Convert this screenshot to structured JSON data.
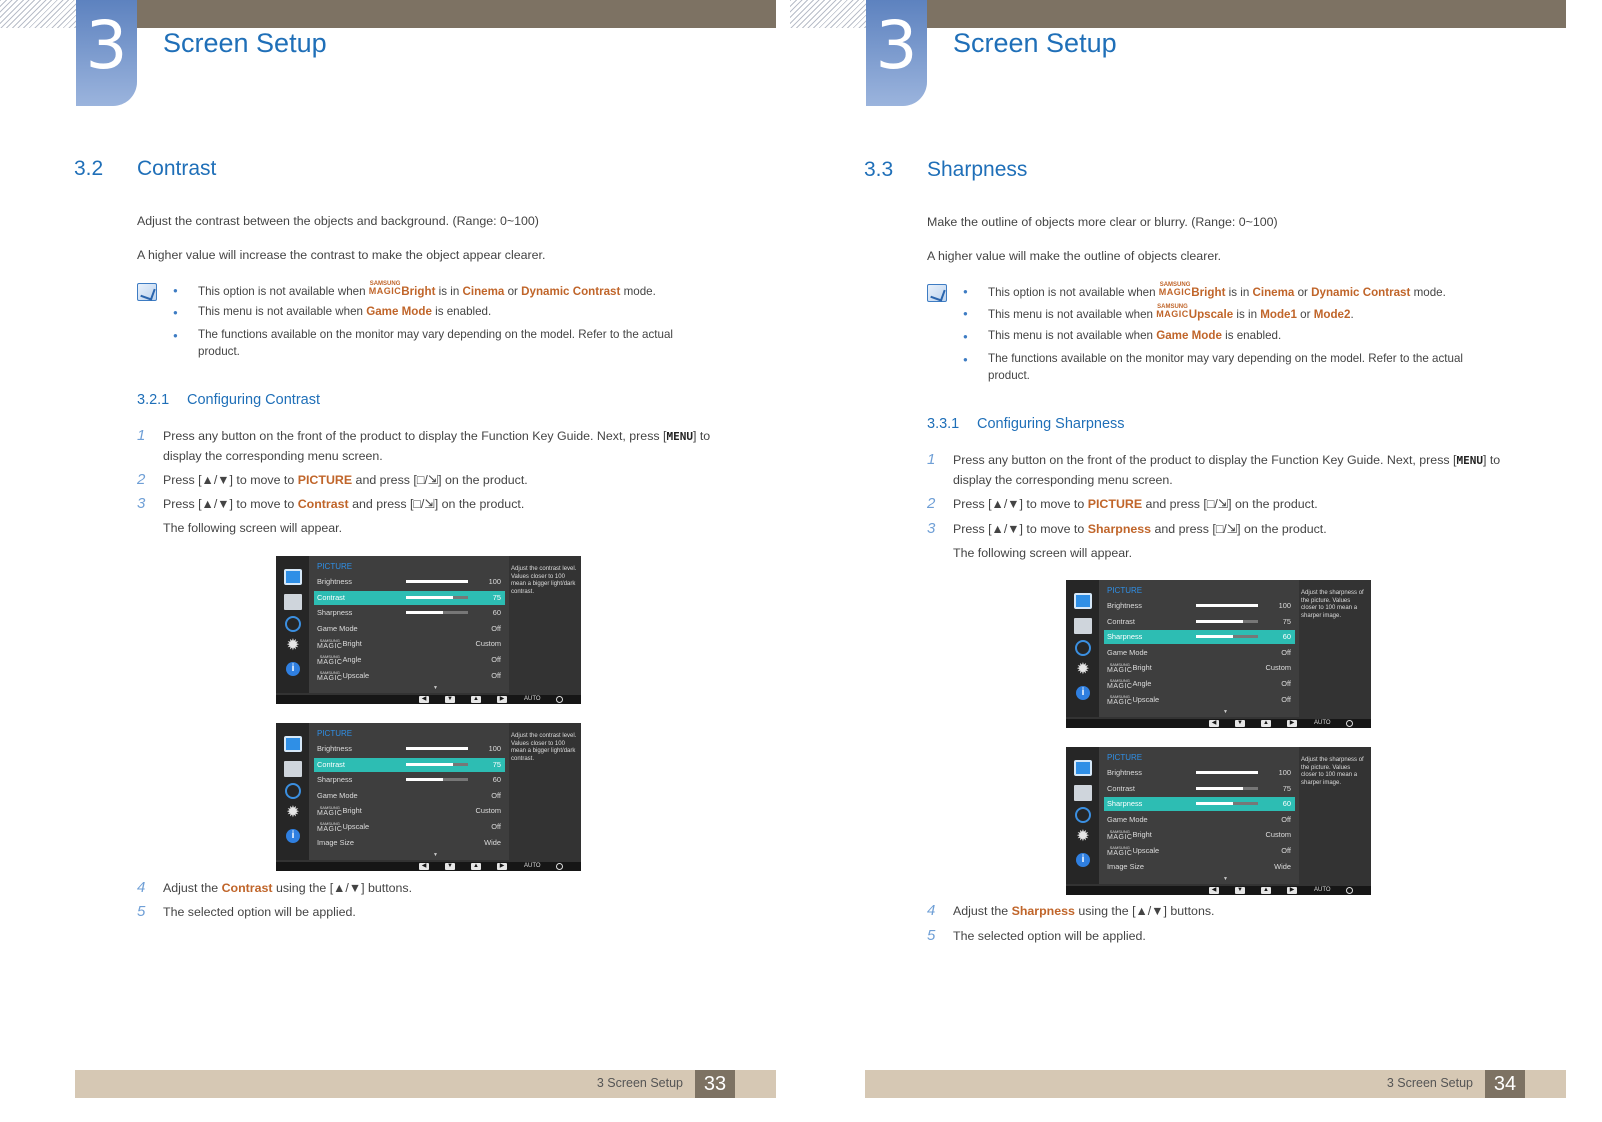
{
  "left": {
    "chapter_number": "3",
    "chapter_title": "Screen Setup",
    "section_number": "3.2",
    "section_title": "Contrast",
    "intro": [
      "Adjust the contrast between the objects and background. (Range: 0~100)",
      "A higher value will increase the contrast to make the object appear clearer."
    ],
    "notes": [
      {
        "pre": "This option is not available when ",
        "magic_top": "SAMSUNG",
        "magic_bottom": "MAGIC",
        "hl1": "Bright",
        "mid1": " is in ",
        "hl2": "Cinema",
        "mid2": " or ",
        "hl3": "Dynamic Contrast",
        "post": " mode."
      },
      {
        "pre": "This menu is not available when ",
        "hl1": "Game Mode",
        "post": " is enabled."
      },
      {
        "text": "The functions available on the monitor may vary depending on the model. Refer to the actual product."
      }
    ],
    "subsection_number": "3.2.1",
    "subsection_title": "Configuring Contrast",
    "steps": [
      {
        "num": "1",
        "pre": "Press any button on the front of the product to display the Function Key Guide. Next, press [",
        "key": "MENU",
        "post": "] to display the corresponding menu screen."
      },
      {
        "num": "2",
        "pre": "Press [▲/▼] to move to ",
        "hl": "PICTURE",
        "post": " and press [□/⇲] on the product."
      },
      {
        "num": "3",
        "pre": "Press [▲/▼] to move to ",
        "hl": "Contrast",
        "post": " and press [□/⇲] on the product.",
        "extra": "The following screen will appear."
      },
      {
        "num": "4",
        "pre": "Adjust the ",
        "hl": "Contrast",
        "post": " using the [▲/▼] buttons."
      },
      {
        "num": "5",
        "pre": "The selected option will be applied."
      }
    ],
    "osd1": {
      "header": "PICTURE",
      "help": "Adjust the contrast level. Values closer to 100 mean a bigger light/dark contrast.",
      "rows": [
        {
          "magic": "",
          "label": "Brightness",
          "value": "100",
          "level": 100
        },
        {
          "magic": "",
          "label": "Contrast",
          "value": "75",
          "level": 75
        },
        {
          "magic": "",
          "label": "Sharpness",
          "value": "60",
          "level": 60
        },
        {
          "magic": "",
          "label": "Game Mode",
          "value": "Off"
        },
        {
          "magic": "SAMSUNG MAGIC",
          "label": "Bright",
          "value": "Custom"
        },
        {
          "magic": "SAMSUNG MAGIC",
          "label": "Angle",
          "value": "Off"
        },
        {
          "magic": "SAMSUNG MAGIC",
          "label": "Upscale",
          "value": "Off"
        }
      ]
    },
    "osd2": {
      "header": "PICTURE",
      "help": "Adjust the contrast level. Values closer to 100 mean a bigger light/dark contrast.",
      "rows": [
        {
          "magic": "",
          "label": "Brightness",
          "value": "100",
          "level": 100
        },
        {
          "magic": "",
          "label": "Contrast",
          "value": "75",
          "level": 75
        },
        {
          "magic": "",
          "label": "Sharpness",
          "value": "60",
          "level": 60
        },
        {
          "magic": "",
          "label": "Game Mode",
          "value": "Off"
        },
        {
          "magic": "SAMSUNG MAGIC",
          "label": "Bright",
          "value": "Custom"
        },
        {
          "magic": "SAMSUNG MAGIC",
          "label": "Upscale",
          "value": "Off"
        },
        {
          "magic": "",
          "label": "Image Size",
          "value": "Wide"
        }
      ]
    },
    "footer_text": "3 Screen Setup",
    "page_number": "33"
  },
  "right": {
    "chapter_number": "3",
    "chapter_title": "Screen Setup",
    "section_number": "3.3",
    "section_title": "Sharpness",
    "intro": [
      "Make the outline of objects more clear or blurry. (Range: 0~100)",
      "A higher value will make the outline of objects clearer."
    ],
    "notes": [
      {
        "pre": "This option is not available when ",
        "magic_top": "SAMSUNG",
        "magic_bottom": "MAGIC",
        "hl1": "Bright",
        "mid1": " is in ",
        "hl2": "Cinema",
        "mid2": " or ",
        "hl3": "Dynamic Contrast",
        "post": " mode."
      },
      {
        "pre": "This menu is not available when ",
        "magic_top": "SAMSUNG",
        "magic_bottom": "MAGIC",
        "hl1": "Upscale",
        "mid1": " is in ",
        "hl2": "Mode1",
        "mid2": " or ",
        "hl3": "Mode2",
        "post": "."
      },
      {
        "pre": "This menu is not available when ",
        "hl1": "Game Mode",
        "post": " is enabled."
      },
      {
        "text": "The functions available on the monitor may vary depending on the model. Refer to the actual product."
      }
    ],
    "subsection_number": "3.3.1",
    "subsection_title": "Configuring Sharpness",
    "steps": [
      {
        "num": "1",
        "pre": "Press any button on the front of the product to display the Function Key Guide. Next, press [",
        "key": "MENU",
        "post": "] to display the corresponding menu screen."
      },
      {
        "num": "2",
        "pre": "Press [▲/▼] to move to ",
        "hl": "PICTURE",
        "post": " and press [□/⇲] on the product."
      },
      {
        "num": "3",
        "pre": "Press [▲/▼] to move to ",
        "hl": "Sharpness",
        "post": " and press [□/⇲] on the product.",
        "extra": "The following screen will appear."
      },
      {
        "num": "4",
        "pre": "Adjust the ",
        "hl": "Sharpness",
        "post": " using the [▲/▼] buttons."
      },
      {
        "num": "5",
        "pre": "The selected option will be applied."
      }
    ],
    "osd1": {
      "header": "PICTURE",
      "help": "Adjust the sharpness of the picture. Values closer to 100 mean a sharper image.",
      "rows": [
        {
          "magic": "",
          "label": "Brightness",
          "value": "100",
          "level": 100
        },
        {
          "magic": "",
          "label": "Contrast",
          "value": "75",
          "level": 75
        },
        {
          "magic": "",
          "label": "Sharpness",
          "value": "60",
          "level": 60
        },
        {
          "magic": "",
          "label": "Game Mode",
          "value": "Off"
        },
        {
          "magic": "SAMSUNG MAGIC",
          "label": "Bright",
          "value": "Custom"
        },
        {
          "magic": "SAMSUNG MAGIC",
          "label": "Angle",
          "value": "Off"
        },
        {
          "magic": "SAMSUNG MAGIC",
          "label": "Upscale",
          "value": "Off"
        }
      ]
    },
    "osd2": {
      "header": "PICTURE",
      "help": "Adjust the sharpness of the picture. Values closer to 100 mean a sharper image.",
      "rows": [
        {
          "magic": "",
          "label": "Brightness",
          "value": "100",
          "level": 100
        },
        {
          "magic": "",
          "label": "Contrast",
          "value": "75",
          "level": 75
        },
        {
          "magic": "",
          "label": "Sharpness",
          "value": "60",
          "level": 60
        },
        {
          "magic": "",
          "label": "Game Mode",
          "value": "Off"
        },
        {
          "magic": "SAMSUNG MAGIC",
          "label": "Bright",
          "value": "Custom"
        },
        {
          "magic": "SAMSUNG MAGIC",
          "label": "Upscale",
          "value": "Off"
        },
        {
          "magic": "",
          "label": "Image Size",
          "value": "Wide"
        }
      ]
    },
    "footer_text": "3 Screen Setup",
    "page_number": "34"
  },
  "osd_footer": {
    "auto_label": "AUTO",
    "keys": [
      "◀",
      "▼",
      "▲",
      "▶"
    ]
  },
  "icons": [
    "monitor-icon",
    "list-icon",
    "cycle-icon",
    "gear-icon",
    "info-icon",
    "power-icon",
    "note-icon"
  ],
  "colors": {
    "heading_blue": "#1f6fb8",
    "highlight_orange": "#c0652a",
    "osd_selected": "#2dbdb3",
    "top_bar": "#7d7263",
    "footer_bar": "#d6c8b4"
  }
}
